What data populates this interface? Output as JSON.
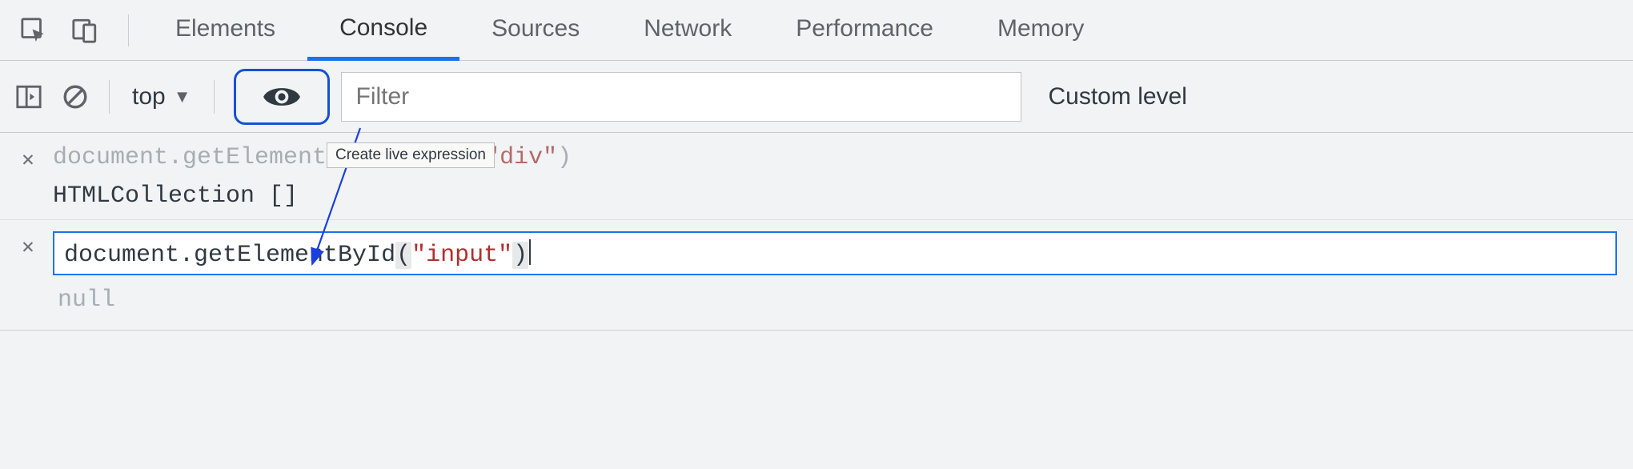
{
  "tabs": {
    "elements": "Elements",
    "console": "Console",
    "sources": "Sources",
    "network": "Network",
    "performance": "Performance",
    "memory": "Memory"
  },
  "toolbar": {
    "context": "top",
    "filter_placeholder": "Filter",
    "levels": "Custom level",
    "tooltip": "Create live expression"
  },
  "expressions": [
    {
      "code_prefix": "document.getElementsByTagName(",
      "code_string": "\"div\"",
      "code_suffix": ")",
      "result": "HTMLCollection []"
    },
    {
      "code_prefix": "document.getElementById",
      "open_bracket": "(",
      "code_string": "\"input\"",
      "close_bracket": ")",
      "result": "null"
    }
  ]
}
